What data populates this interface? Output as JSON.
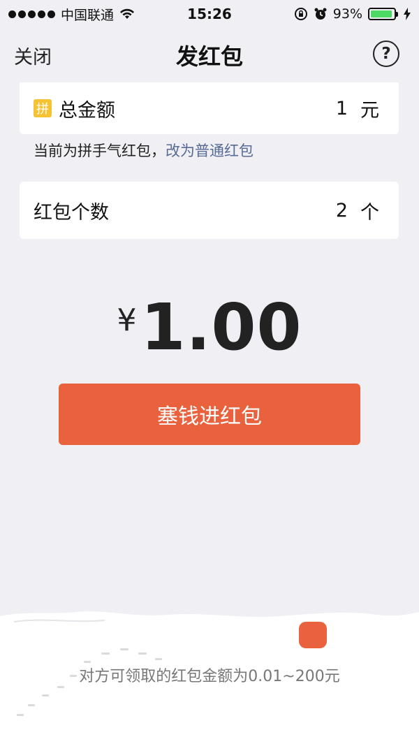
{
  "status_bar": {
    "carrier": "中国联通",
    "time": "15:26",
    "battery_percent": "93%",
    "battery_level": 0.93,
    "icons": [
      "signal-dots-icon",
      "wifi-icon",
      "rotation-lock-icon",
      "alarm-icon",
      "battery-icon",
      "charging-icon"
    ]
  },
  "nav": {
    "close_label": "关闭",
    "title": "发红包",
    "help_label": "?"
  },
  "total_amount": {
    "badge": "拼",
    "label": "总金额",
    "value": "1",
    "unit": "元"
  },
  "hint": {
    "text": "当前为拼手气红包，",
    "link": "改为普通红包"
  },
  "packet_count": {
    "label": "红包个数",
    "value": "2",
    "unit": "个"
  },
  "amount_display": {
    "symbol": "¥",
    "value": "1.00"
  },
  "primary_button": {
    "label": "塞钱进红包"
  },
  "footer": {
    "note": "对方可领取的红包金额为0.01~200元"
  },
  "colors": {
    "accent": "#e9613d",
    "link": "#576b95",
    "background": "#efeff4",
    "badge": "#f4c233",
    "battery": "#4cd964"
  }
}
